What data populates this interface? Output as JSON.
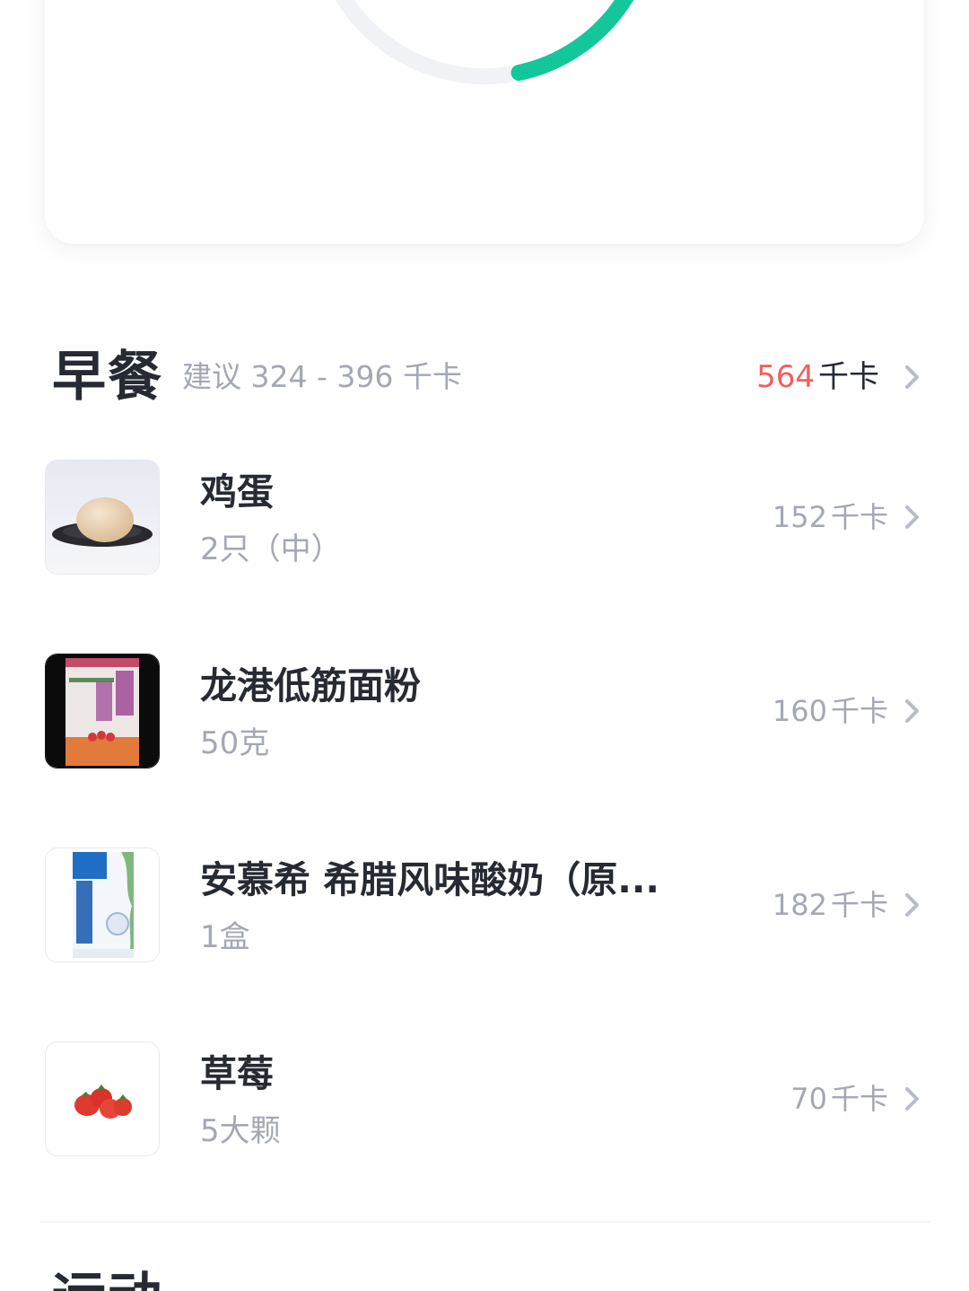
{
  "summary": {
    "progress_fraction": 0.32,
    "progress_color": "#14c79a",
    "track_color": "#f1f2f5"
  },
  "breakfast": {
    "title": "早餐",
    "suggestion": "建议 324 - 396 千卡",
    "total_value": "564",
    "total_unit": "千卡",
    "total_color": "#f0605c",
    "items": [
      {
        "name": "鸡蛋",
        "amount": "2只（中）",
        "kcal": "152",
        "unit": "千卡",
        "image": "egg-photo"
      },
      {
        "name": "龙港低筋面粉",
        "amount": "50克",
        "kcal": "160",
        "unit": "千卡",
        "image": "flour-bag-photo"
      },
      {
        "name": "安慕希 希腊风味酸奶（原...",
        "amount": "1盒",
        "kcal": "182",
        "unit": "千卡",
        "image": "yogurt-box-photo"
      },
      {
        "name": "草莓",
        "amount": "5大颗",
        "kcal": "70",
        "unit": "千卡",
        "image": "strawberries-photo"
      }
    ]
  },
  "next_section": {
    "title": "运动"
  }
}
